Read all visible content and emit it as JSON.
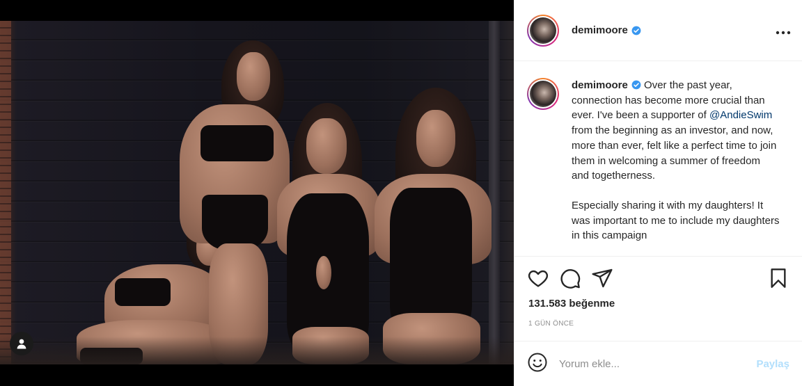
{
  "post": {
    "username": "demimoore",
    "more_icon": "more-horizontal-icon",
    "verified_icon": "verified-badge-icon"
  },
  "caption": {
    "username": "demimoore",
    "text_1": " Over the past year, connection has become more crucial than ever. I've been a supporter of ",
    "mention": "@AndieSwim",
    "text_2": " from the beginning as an investor, and now, more than ever, felt like a perfect time to join them in welcoming a summer of freedom and togetherness.",
    "paragraph_2": "Especially sharing it with my daughters! It was important to me to include my daughters in this campaign"
  },
  "actions": {
    "like_icon": "heart-icon",
    "comment_icon": "comment-icon",
    "share_icon": "paper-plane-icon",
    "save_icon": "bookmark-icon"
  },
  "likes": "131.583 beğenme",
  "timestamp": "1 GÜN ÖNCE",
  "comment": {
    "placeholder": "Yorum ekle...",
    "post_label": "Paylaş",
    "emoji_icon": "smiley-icon"
  },
  "media": {
    "tagged_users_icon": "user-icon"
  },
  "colors": {
    "accent_blue": "#0095f6",
    "mention_blue": "#00376b",
    "disabled_post": "#b2dffc",
    "secondary_text": "#8e8e8e"
  }
}
